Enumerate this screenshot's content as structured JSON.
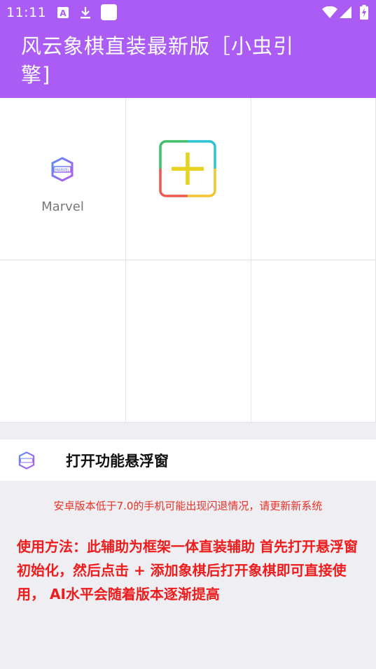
{
  "status_bar": {
    "time": "11:11",
    "icons": [
      "app-a-icon",
      "download-icon",
      "white-square-icon",
      "wifi-icon",
      "signal-icon",
      "battery-charging-icon"
    ]
  },
  "app_bar": {
    "title": "风云象棋直装最新版［小虫引擎]",
    "background_color": "#ab5cf5"
  },
  "app_grid": {
    "apps": [
      {
        "name": "Marvel",
        "icon": "marvel-logo-icon"
      },
      {
        "name": "",
        "icon": "add-plus-icon"
      }
    ]
  },
  "floating_window": {
    "icon": "marvel-logo-icon",
    "label": "打开功能悬浮窗"
  },
  "notice": "安卓版本低于7.0的手机可能出现闪退情况，请更新新系统",
  "usage_text": "使用方法：此辅助为框架一体直装辅助 首先打开悬浮窗初始化，然后点击 + 添加象棋后打开象棋即可直接使用， AI水平会随着版本逐渐提高",
  "colors": {
    "notice_text": "#e53226",
    "usage_text": "#ee1d1d"
  }
}
